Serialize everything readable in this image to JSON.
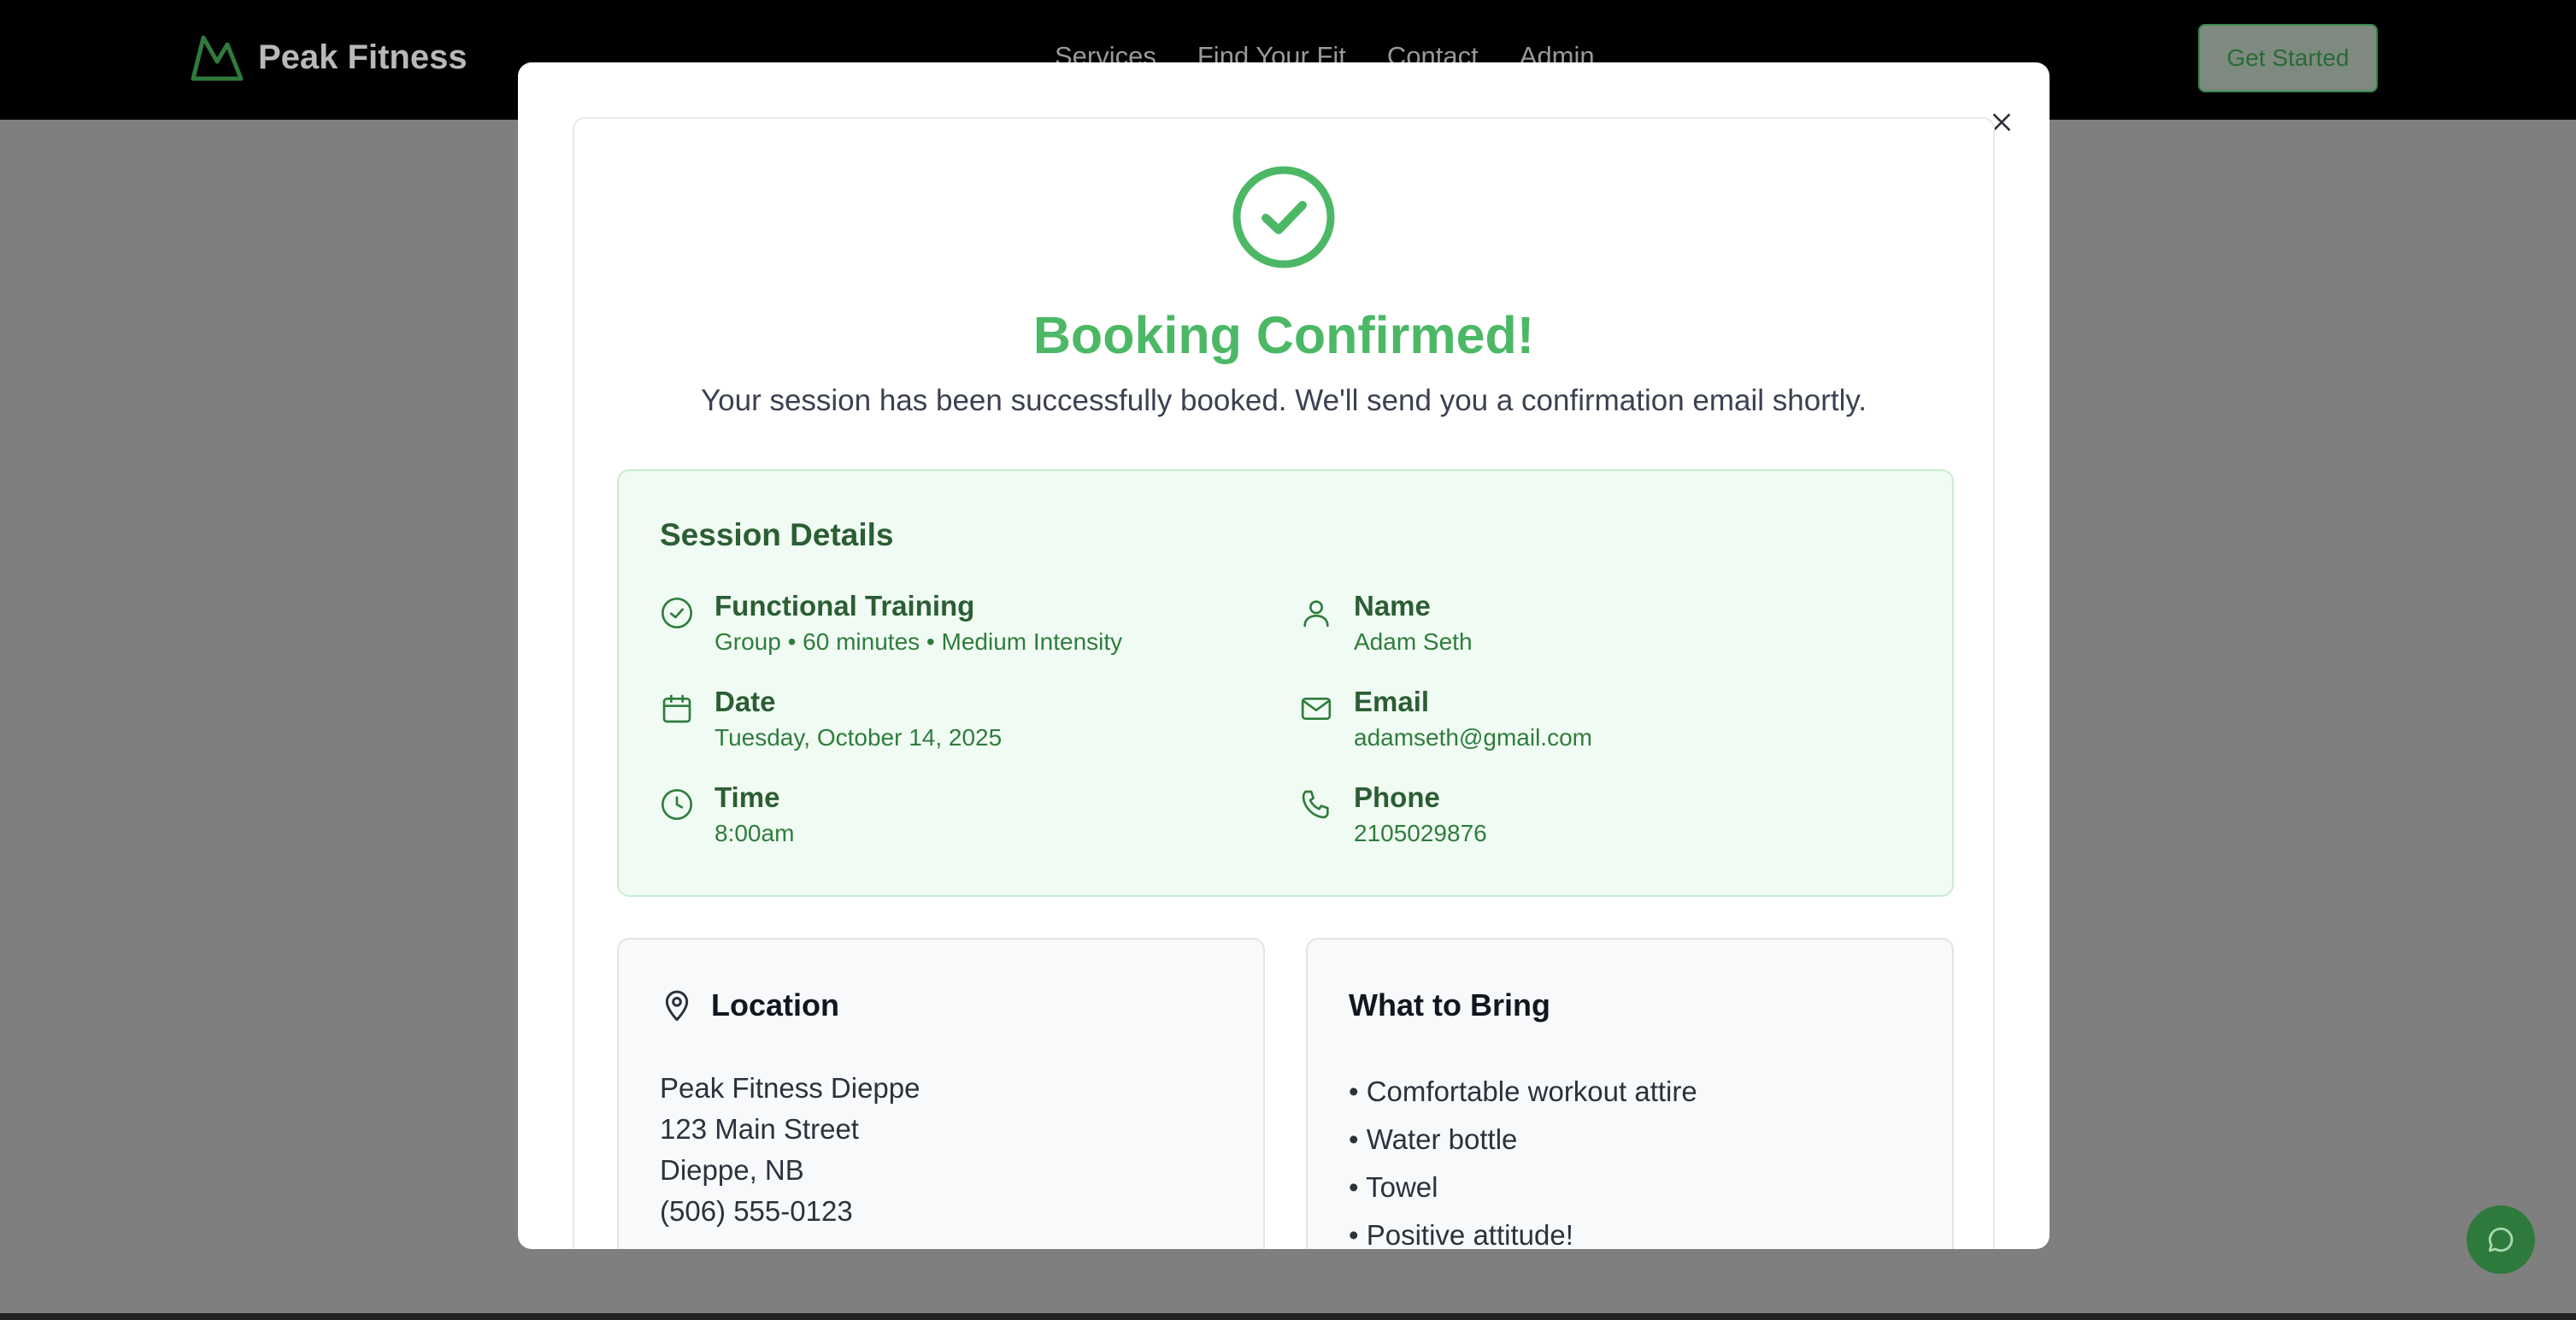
{
  "header": {
    "brand": "Peak Fitness",
    "nav": [
      "Services",
      "Find Your Fit",
      "Contact",
      "Admin"
    ],
    "cta": "Get Started"
  },
  "modal": {
    "title": "Booking Confirmed!",
    "subtitle": "Your session has been successfully booked. We'll send you a confirmation email shortly.",
    "session": {
      "heading": "Session Details",
      "service_label": "Functional Training",
      "service_value": "Group • 60 minutes • Medium Intensity",
      "date_label": "Date",
      "date_value": "Tuesday, October 14, 2025",
      "time_label": "Time",
      "time_value": "8:00am",
      "name_label": "Name",
      "name_value": "Adam Seth",
      "email_label": "Email",
      "email_value": "adamseth@gmail.com",
      "phone_label": "Phone",
      "phone_value": "2105029876"
    },
    "location": {
      "heading": "Location",
      "lines": [
        "Peak Fitness Dieppe",
        "123 Main Street",
        "Dieppe, NB",
        "(506) 555-0123"
      ]
    },
    "bring": {
      "heading": "What to Bring",
      "items": [
        "• Comfortable workout attire",
        "• Water bottle",
        "• Towel",
        "• Positive attitude!"
      ]
    }
  },
  "colors": {
    "accent_green": "#4cb866",
    "dark_green": "#2b5e33",
    "details_bg": "#f0fbf3",
    "overlay": "#7f7f7f"
  },
  "icons": {
    "brand": "mountain-logo-icon",
    "success": "check-circle-icon",
    "service": "check-circle-small-icon",
    "date": "calendar-icon",
    "time": "clock-icon",
    "name": "user-icon",
    "email": "mail-icon",
    "phone": "phone-icon",
    "location": "map-pin-icon",
    "close": "close-icon",
    "chat": "chat-bubble-icon"
  }
}
